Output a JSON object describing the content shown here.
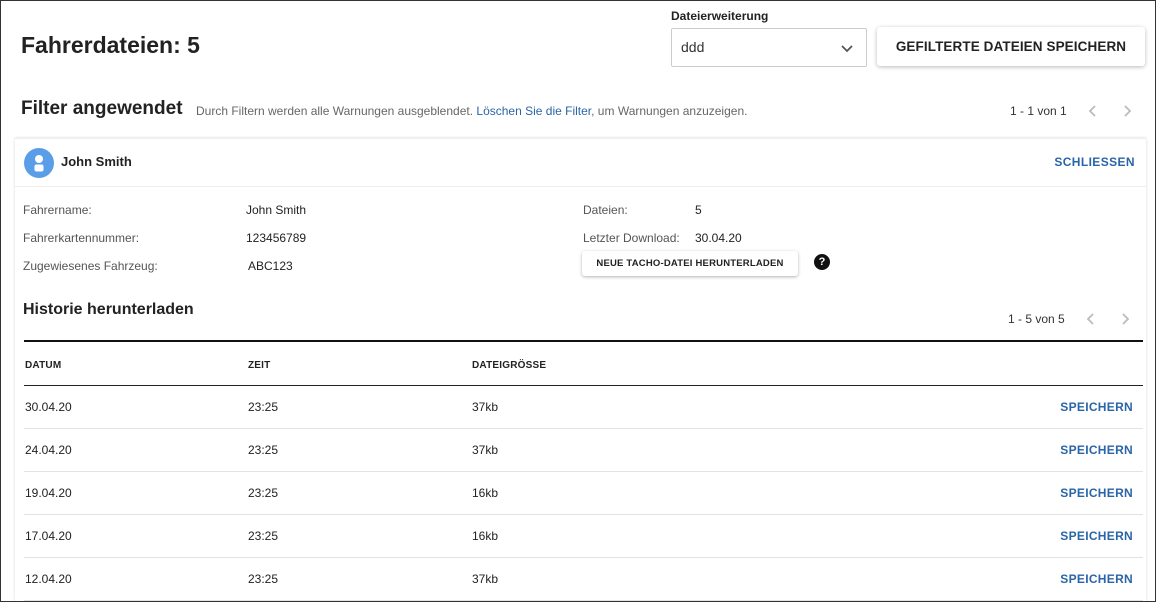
{
  "header": {
    "title": "Fahrerdateien: 5",
    "extension_label": "Dateierweiterung",
    "extension_value": "ddd",
    "save_filtered_label": "GEFILTERTE DATEIEN SPEICHERN"
  },
  "filter": {
    "title": "Filter angewendet",
    "message_prefix": "Durch Filtern werden alle Warnungen ausgeblendet.",
    "message_link": "Löschen Sie die Filter",
    "message_suffix": ", um Warnungen anzuzeigen.",
    "pagination": "1 - 1 von 1"
  },
  "driver": {
    "name": "John Smith",
    "close_label": "SCHLIESSEN",
    "fields_left": [
      {
        "label": "Fahrername:",
        "value": "John Smith"
      },
      {
        "label": "Fahrerkartennummer:",
        "value": "123456789"
      },
      {
        "label": "Zugewiesenes Fahrzeug:",
        "value": "ABC123"
      }
    ],
    "fields_right": [
      {
        "label": "Dateien:",
        "value": "5"
      },
      {
        "label": "Letzter Download:",
        "value": "30.04.20"
      }
    ],
    "download_button": "NEUE TACHO-DATEI HERUNTERLADEN",
    "help_icon": "?"
  },
  "history": {
    "title": "Historie herunterladen",
    "pagination": "1 - 5 von 5",
    "columns": [
      "DATUM",
      "ZEIT",
      "DATEIGRÖSSE"
    ],
    "save_label": "SPEICHERN",
    "rows": [
      {
        "date": "30.04.20",
        "time": "23:25",
        "size": "37kb"
      },
      {
        "date": "24.04.20",
        "time": "23:25",
        "size": "37kb"
      },
      {
        "date": "19.04.20",
        "time": "23:25",
        "size": "16kb"
      },
      {
        "date": "17.04.20",
        "time": "23:25",
        "size": "16kb"
      },
      {
        "date": "12.04.20",
        "time": "23:25",
        "size": "37kb"
      }
    ]
  },
  "colors": {
    "accent": "#2a65a8",
    "avatar": "#5b9ee8"
  }
}
